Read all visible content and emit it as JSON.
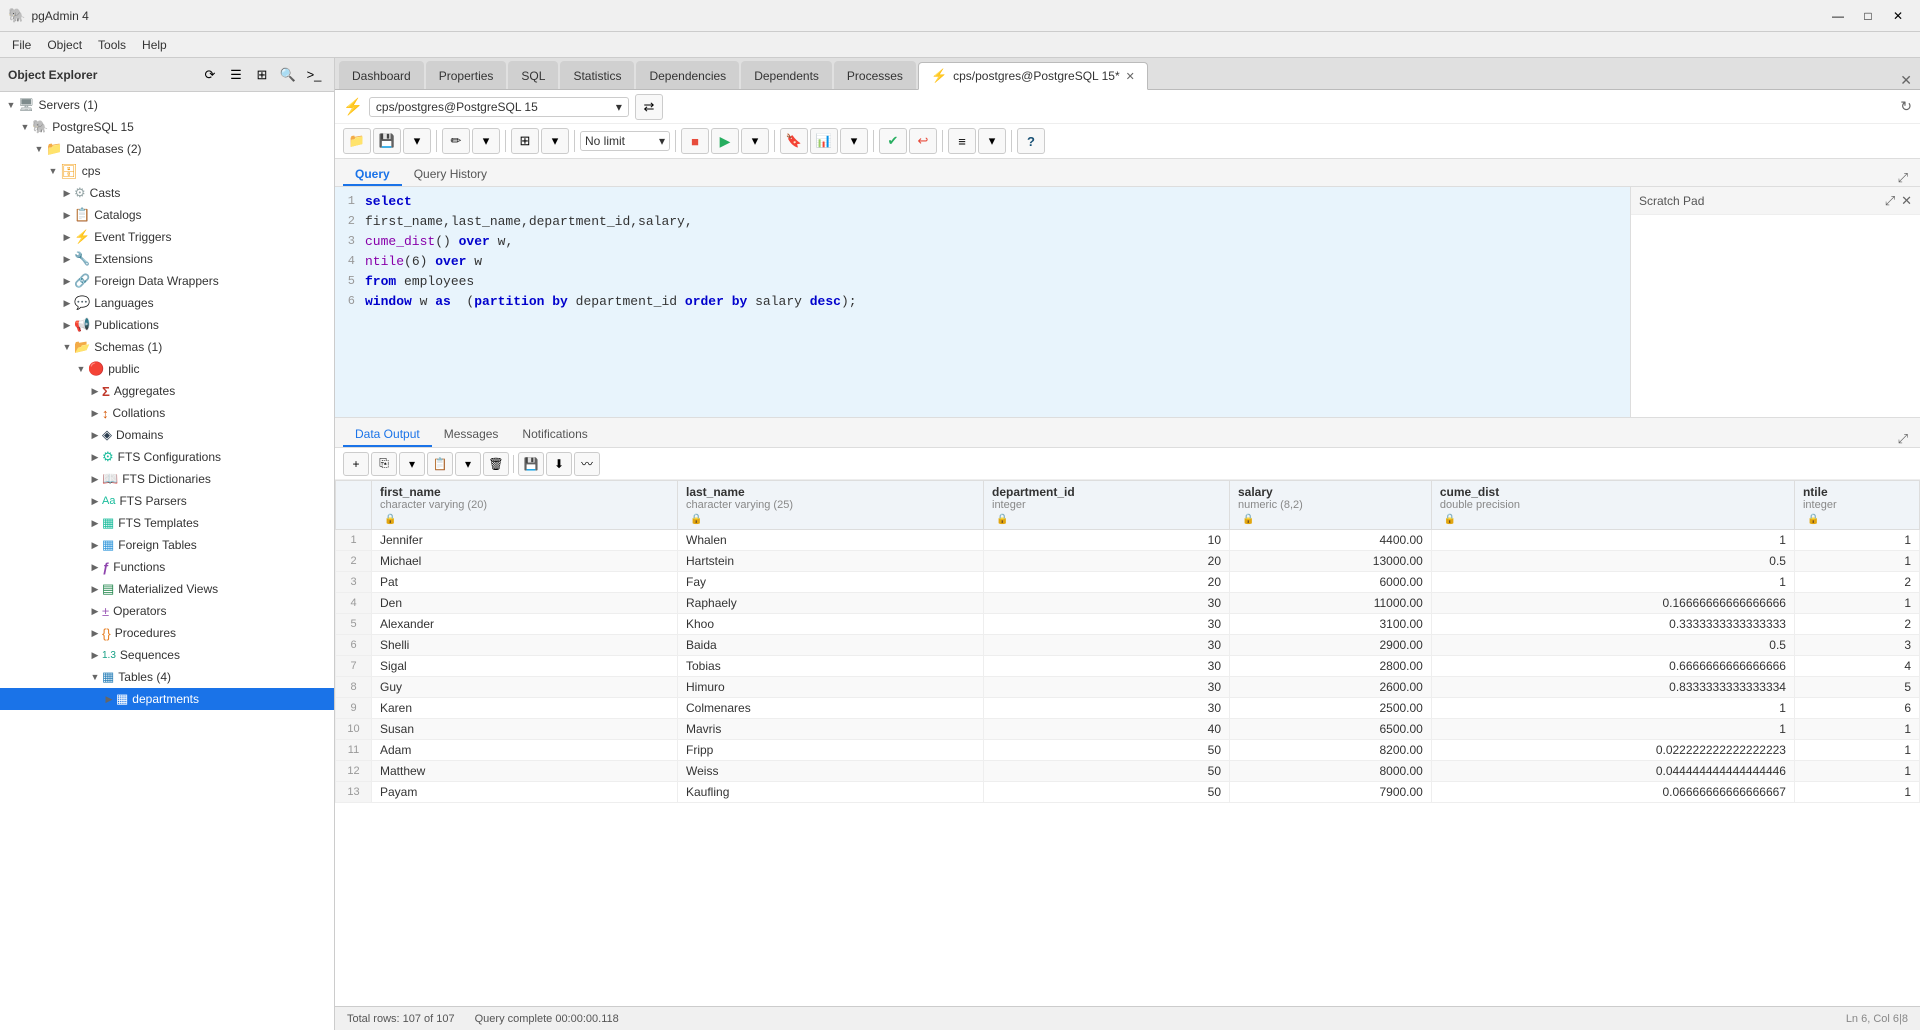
{
  "app": {
    "title": "pgAdmin 4",
    "icon": "🐘"
  },
  "window_controls": {
    "minimize": "—",
    "maximize": "□",
    "close": "✕"
  },
  "menu": {
    "items": [
      "File",
      "Object",
      "Tools",
      "Help"
    ]
  },
  "object_explorer": {
    "title": "Object Explorer",
    "toolbar_buttons": [
      "refresh",
      "properties",
      "sql",
      "search",
      "terminal"
    ],
    "tree": [
      {
        "id": "servers",
        "label": "Servers (1)",
        "icon": "🖥",
        "indent": 0,
        "expanded": true,
        "type": "servers"
      },
      {
        "id": "pg15",
        "label": "PostgreSQL 15",
        "icon": "🐘",
        "indent": 1,
        "expanded": true,
        "type": "server"
      },
      {
        "id": "databases",
        "label": "Databases (2)",
        "icon": "📁",
        "indent": 2,
        "expanded": true,
        "type": "folder"
      },
      {
        "id": "cps",
        "label": "cps",
        "icon": "🗄",
        "indent": 3,
        "expanded": true,
        "type": "database"
      },
      {
        "id": "casts",
        "label": "Casts",
        "icon": "⚙",
        "indent": 4,
        "expanded": false,
        "type": "folder"
      },
      {
        "id": "catalogs",
        "label": "Catalogs",
        "icon": "📋",
        "indent": 4,
        "expanded": false,
        "type": "folder"
      },
      {
        "id": "event_triggers",
        "label": "Event Triggers",
        "icon": "⚡",
        "indent": 4,
        "expanded": false,
        "type": "folder"
      },
      {
        "id": "extensions",
        "label": "Extensions",
        "icon": "🔧",
        "indent": 4,
        "expanded": false,
        "type": "folder"
      },
      {
        "id": "fdw",
        "label": "Foreign Data Wrappers",
        "icon": "🔗",
        "indent": 4,
        "expanded": false,
        "type": "folder"
      },
      {
        "id": "languages",
        "label": "Languages",
        "icon": "💬",
        "indent": 4,
        "expanded": false,
        "type": "folder"
      },
      {
        "id": "publications",
        "label": "Publications",
        "icon": "📢",
        "indent": 4,
        "expanded": false,
        "type": "folder"
      },
      {
        "id": "schemas",
        "label": "Schemas (1)",
        "icon": "📂",
        "indent": 4,
        "expanded": true,
        "type": "folder"
      },
      {
        "id": "public",
        "label": "public",
        "icon": "🔴",
        "indent": 5,
        "expanded": true,
        "type": "schema"
      },
      {
        "id": "aggregates",
        "label": "Aggregates",
        "icon": "Σ",
        "indent": 6,
        "expanded": false,
        "type": "folder"
      },
      {
        "id": "collations",
        "label": "Collations",
        "icon": "↕",
        "indent": 6,
        "expanded": false,
        "type": "folder"
      },
      {
        "id": "domains",
        "label": "Domains",
        "icon": "◈",
        "indent": 6,
        "expanded": false,
        "type": "folder"
      },
      {
        "id": "fts_configs",
        "label": "FTS Configurations",
        "icon": "⚙",
        "indent": 6,
        "expanded": false,
        "type": "folder"
      },
      {
        "id": "fts_dicts",
        "label": "FTS Dictionaries",
        "icon": "📖",
        "indent": 6,
        "expanded": false,
        "type": "folder"
      },
      {
        "id": "fts_parsers",
        "label": "FTS Parsers",
        "icon": "Aa",
        "indent": 6,
        "expanded": false,
        "type": "folder"
      },
      {
        "id": "fts_templates",
        "label": "FTS Templates",
        "icon": "▦",
        "indent": 6,
        "expanded": false,
        "type": "folder"
      },
      {
        "id": "foreign_tables",
        "label": "Foreign Tables",
        "icon": "▦",
        "indent": 6,
        "expanded": false,
        "type": "folder"
      },
      {
        "id": "functions",
        "label": "Functions",
        "icon": "ƒ",
        "indent": 6,
        "expanded": false,
        "type": "folder"
      },
      {
        "id": "mat_views",
        "label": "Materialized Views",
        "icon": "▤",
        "indent": 6,
        "expanded": false,
        "type": "folder"
      },
      {
        "id": "operators",
        "label": "Operators",
        "icon": "±",
        "indent": 6,
        "expanded": false,
        "type": "folder"
      },
      {
        "id": "procedures",
        "label": "Procedures",
        "icon": "{}",
        "indent": 6,
        "expanded": false,
        "type": "folder"
      },
      {
        "id": "sequences",
        "label": "Sequences",
        "icon": "1.3",
        "indent": 6,
        "expanded": false,
        "type": "folder"
      },
      {
        "id": "tables",
        "label": "Tables (4)",
        "icon": "▦",
        "indent": 6,
        "expanded": true,
        "type": "folder"
      },
      {
        "id": "departments",
        "label": "departments",
        "icon": "▦",
        "indent": 7,
        "expanded": false,
        "type": "table",
        "selected": true
      }
    ]
  },
  "tabs": [
    {
      "id": "dashboard",
      "label": "Dashboard",
      "icon": "",
      "active": false
    },
    {
      "id": "properties",
      "label": "Properties",
      "icon": "",
      "active": false
    },
    {
      "id": "sql",
      "label": "SQL",
      "icon": "",
      "active": false
    },
    {
      "id": "statistics",
      "label": "Statistics",
      "icon": "",
      "active": false
    },
    {
      "id": "dependencies",
      "label": "Dependencies",
      "icon": "",
      "active": false
    },
    {
      "id": "dependents",
      "label": "Dependents",
      "icon": "",
      "active": false
    },
    {
      "id": "processes",
      "label": "Processes",
      "icon": "",
      "active": false
    },
    {
      "id": "query_tool",
      "label": "cps/postgres@PostgreSQL 15*",
      "icon": "⚡",
      "active": true,
      "closeable": true
    }
  ],
  "query_tool": {
    "connection": "cps/postgres@PostgreSQL 15",
    "connection_dropdown": "▾",
    "toolbar": {
      "open": "📁",
      "save": "💾",
      "save_arrow": "▾",
      "edit": "✏",
      "edit_arrow": "▾",
      "filter": "⊞",
      "filter_arrow": "▾",
      "limit_label": "No limit",
      "limit_arrow": "▾",
      "stop": "■",
      "run": "▶",
      "run_arrow": "▾",
      "bookmark": "🔖",
      "chart": "📊",
      "chart_arrow": "▾",
      "commit": "✔",
      "rollback": "↩",
      "format": "≡",
      "format_arrow": "▾",
      "help": "?"
    },
    "sub_tabs": [
      "Query",
      "Query History"
    ],
    "active_sub_tab": "Query",
    "sql": [
      {
        "line": 1,
        "code": "select"
      },
      {
        "line": 2,
        "code": "first_name,last_name,department_id,salary,"
      },
      {
        "line": 3,
        "code": "cume_dist() over w,"
      },
      {
        "line": 4,
        "code": "ntile(6) over w"
      },
      {
        "line": 5,
        "code": "from employees"
      },
      {
        "line": 6,
        "code": "window w as  (partition by department_id order by salary desc);"
      }
    ],
    "scratch_pad": {
      "title": "Scratch Pad",
      "close": "✕",
      "expand": "⤢"
    }
  },
  "data_output": {
    "sub_tabs": [
      "Data Output",
      "Messages",
      "Notifications"
    ],
    "active_sub_tab": "Data Output",
    "expand_icon": "⤢",
    "toolbar": {
      "add_row": "+",
      "copy": "⎘",
      "copy_arrow": "▾",
      "paste": "📋",
      "paste_arrow": "▾",
      "delete": "🗑",
      "save": "💾",
      "download": "⬇",
      "graph": "〰"
    },
    "columns": [
      {
        "name": "first_name",
        "type": "character varying (20)",
        "has_lock": true
      },
      {
        "name": "last_name",
        "type": "character varying (25)",
        "has_lock": true
      },
      {
        "name": "department_id",
        "type": "integer",
        "has_lock": true
      },
      {
        "name": "salary",
        "type": "numeric (8,2)",
        "has_lock": true
      },
      {
        "name": "cume_dist",
        "type": "double precision",
        "has_lock": true
      },
      {
        "name": "ntile",
        "type": "integer",
        "has_lock": true
      }
    ],
    "rows": [
      {
        "num": 1,
        "first_name": "Jennifer",
        "last_name": "Whalen",
        "department_id": 10,
        "salary": "4400.00",
        "cume_dist": "1",
        "ntile": 1
      },
      {
        "num": 2,
        "first_name": "Michael",
        "last_name": "Hartstein",
        "department_id": 20,
        "salary": "13000.00",
        "cume_dist": "0.5",
        "ntile": 1
      },
      {
        "num": 3,
        "first_name": "Pat",
        "last_name": "Fay",
        "department_id": 20,
        "salary": "6000.00",
        "cume_dist": "1",
        "ntile": 2
      },
      {
        "num": 4,
        "first_name": "Den",
        "last_name": "Raphaely",
        "department_id": 30,
        "salary": "11000.00",
        "cume_dist": "0.16666666666666666",
        "ntile": 1
      },
      {
        "num": 5,
        "first_name": "Alexander",
        "last_name": "Khoo",
        "department_id": 30,
        "salary": "3100.00",
        "cume_dist": "0.3333333333333333",
        "ntile": 2
      },
      {
        "num": 6,
        "first_name": "Shelli",
        "last_name": "Baida",
        "department_id": 30,
        "salary": "2900.00",
        "cume_dist": "0.5",
        "ntile": 3
      },
      {
        "num": 7,
        "first_name": "Sigal",
        "last_name": "Tobias",
        "department_id": 30,
        "salary": "2800.00",
        "cume_dist": "0.6666666666666666",
        "ntile": 4
      },
      {
        "num": 8,
        "first_name": "Guy",
        "last_name": "Himuro",
        "department_id": 30,
        "salary": "2600.00",
        "cume_dist": "0.8333333333333334",
        "ntile": 5
      },
      {
        "num": 9,
        "first_name": "Karen",
        "last_name": "Colmenares",
        "department_id": 30,
        "salary": "2500.00",
        "cume_dist": "1",
        "ntile": 6
      },
      {
        "num": 10,
        "first_name": "Susan",
        "last_name": "Mavris",
        "department_id": 40,
        "salary": "6500.00",
        "cume_dist": "1",
        "ntile": 1
      },
      {
        "num": 11,
        "first_name": "Adam",
        "last_name": "Fripp",
        "department_id": 50,
        "salary": "8200.00",
        "cume_dist": "0.022222222222222223",
        "ntile": 1
      },
      {
        "num": 12,
        "first_name": "Matthew",
        "last_name": "Weiss",
        "department_id": 50,
        "salary": "8000.00",
        "cume_dist": "0.044444444444444446",
        "ntile": 1
      },
      {
        "num": 13,
        "first_name": "Payam",
        "last_name": "Kaufling",
        "department_id": 50,
        "salary": "7900.00",
        "cume_dist": "0.06666666666666667",
        "ntile": 1
      }
    ],
    "status": {
      "total_rows": "Total rows: 107 of 107",
      "query_complete": "Query complete 00:00:00.118"
    }
  },
  "status_bar": {
    "line_col": "Ln 6, Col 6|8"
  }
}
